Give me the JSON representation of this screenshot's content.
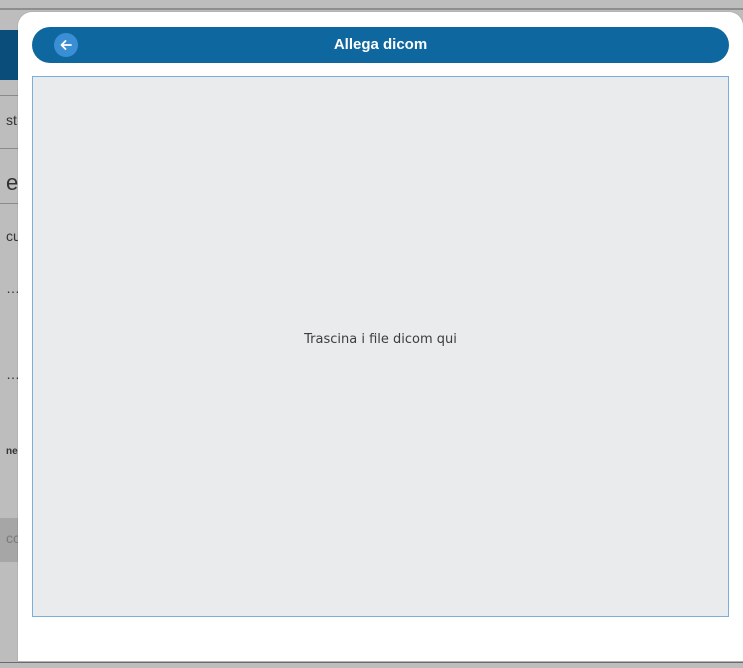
{
  "background": {
    "left_texts": [
      "st",
      "e",
      "cu",
      "…",
      "…",
      "ne",
      "cc"
    ]
  },
  "dialog": {
    "title": "Allega dicom",
    "back_icon": "arrow-left-icon",
    "drop_zone": {
      "text": "Trascina i file dicom qui"
    }
  },
  "colors": {
    "header_bg": "#0f67a0",
    "back_button_bg": "#3a8fd4",
    "drop_zone_bg": "#e9ebed",
    "drop_zone_border": "#79aedd"
  }
}
